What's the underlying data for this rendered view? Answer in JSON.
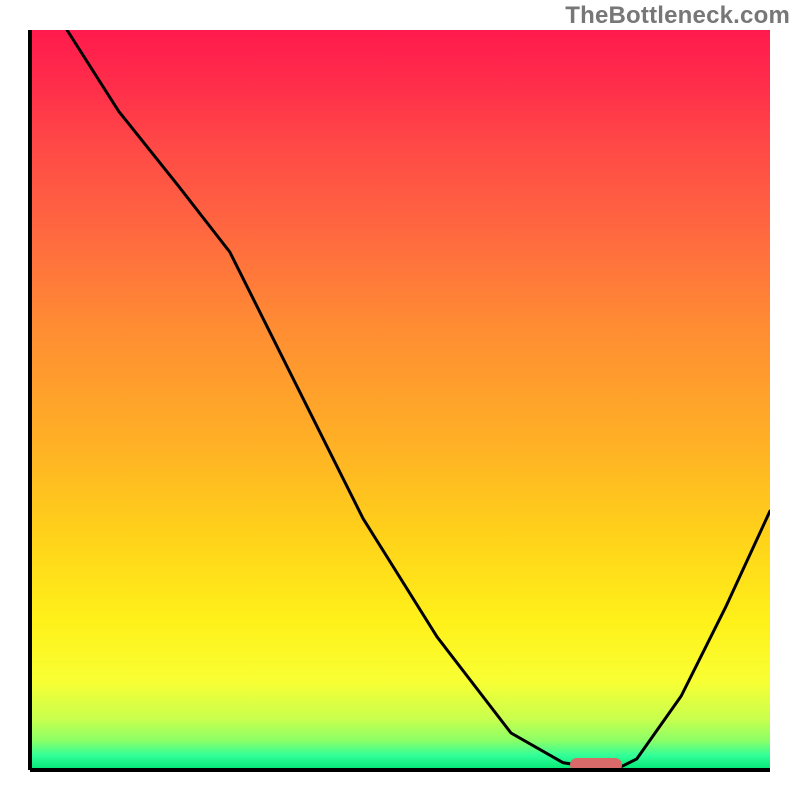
{
  "watermark": "TheBottleneck.com",
  "chart_data": {
    "type": "line",
    "title": "",
    "xlabel": "",
    "ylabel": "",
    "xlim": [
      0,
      100
    ],
    "ylim": [
      0,
      100
    ],
    "grid": false,
    "series": [
      {
        "name": "curve",
        "x": [
          5,
          12,
          20,
          27,
          36,
          45,
          55,
          65,
          72,
          75,
          80,
          82,
          88,
          94,
          100
        ],
        "values": [
          100,
          89,
          79,
          70,
          52,
          34,
          18,
          5,
          1,
          0.5,
          0.5,
          1.5,
          10,
          22,
          35
        ]
      }
    ],
    "marker": {
      "x_start": 73,
      "x_end": 80,
      "y": 0
    },
    "gradient_stops": [
      {
        "pct": 0,
        "color": "#ff1a4d"
      },
      {
        "pct": 50,
        "color": "#ffae26"
      },
      {
        "pct": 90,
        "color": "#f8ff33"
      },
      {
        "pct": 100,
        "color": "#00e673"
      }
    ]
  }
}
